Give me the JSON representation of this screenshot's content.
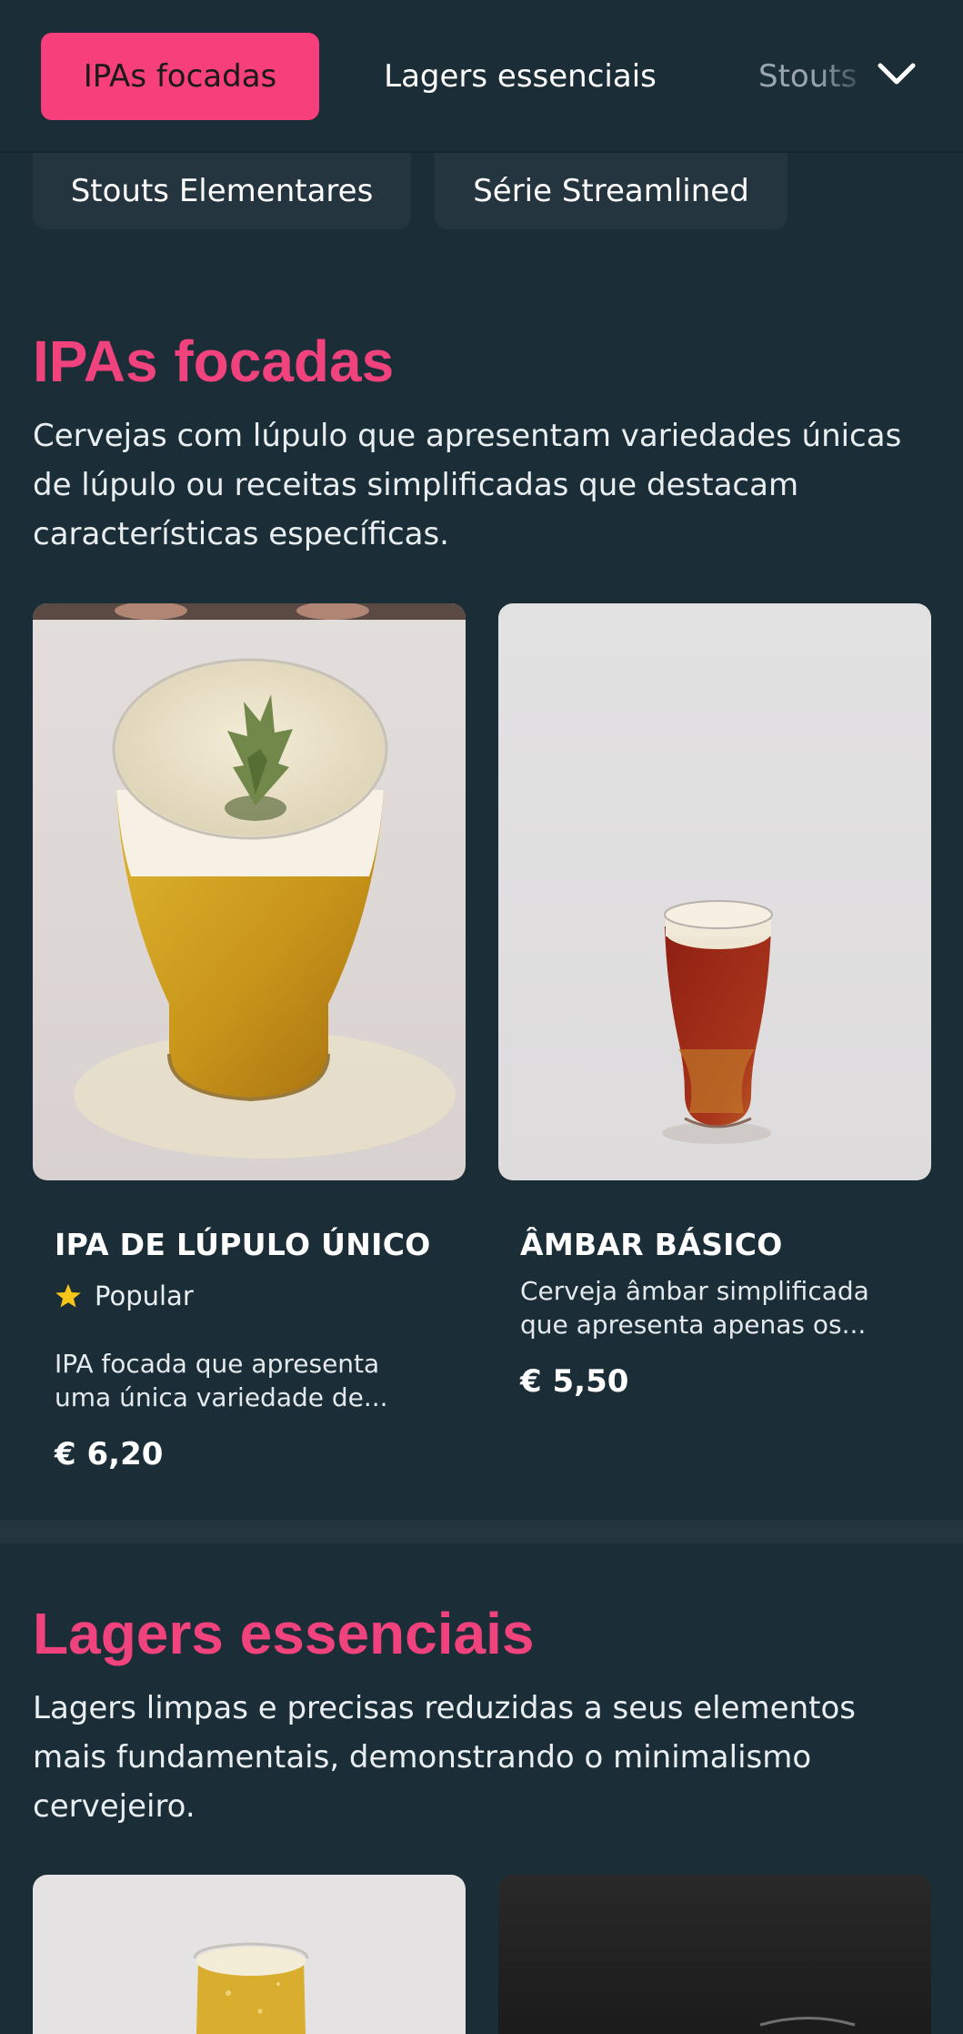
{
  "nav": {
    "tabs": [
      {
        "label": "IPAs focadas",
        "active": true
      },
      {
        "label": "Lagers essenciais",
        "active": false
      },
      {
        "label": "Stouts",
        "active": false
      }
    ],
    "more_icon": "chevron-down-icon",
    "chips": [
      "Stouts Elementares",
      "Série Streamlined"
    ]
  },
  "sections": [
    {
      "title": "IPAs focadas",
      "description": "Cervejas com lúpulo que apresentam variedades únicas de lúpulo ou receitas simplificadas que destacam características específicas.",
      "products": [
        {
          "name": "IPA DE LÚPULO ÚNICO",
          "badge": "Popular",
          "badge_icon": "star-icon",
          "description": "IPA focada que apresenta uma única variedade de...",
          "price": "€ 6,20"
        },
        {
          "name": "ÂMBAR BÁSICO",
          "description": "Cerveja âmbar simplificada que apresenta apenas os...",
          "price": "€ 5,50"
        }
      ]
    },
    {
      "title": "Lagers essenciais",
      "description": "Lagers limpas e precisas reduzidas a seus elementos mais fundamentais, demonstrando o minimalismo cervejeiro."
    }
  ],
  "colors": {
    "background": "#1b2d36",
    "accent": "#f63f7b",
    "chip": "#243540",
    "star": "#f5c518"
  }
}
